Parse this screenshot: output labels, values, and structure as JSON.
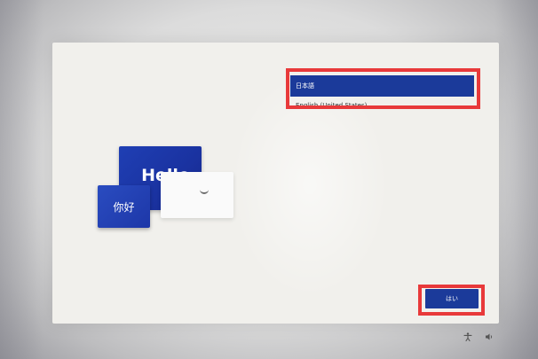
{
  "illustration": {
    "hello_text": "Hello",
    "nihao_text": "你好"
  },
  "languages": {
    "items": [
      {
        "label": "日本語",
        "selected": true
      },
      {
        "label": "English (United States)",
        "selected": false
      }
    ]
  },
  "actions": {
    "yes_label": "はい"
  },
  "tray": {
    "accessibility_icon": "accessibility-icon",
    "volume_icon": "volume-icon"
  },
  "colors": {
    "accent": "#1b3a9a",
    "highlight": "#e8393a",
    "panel": "#f1f0ec"
  }
}
